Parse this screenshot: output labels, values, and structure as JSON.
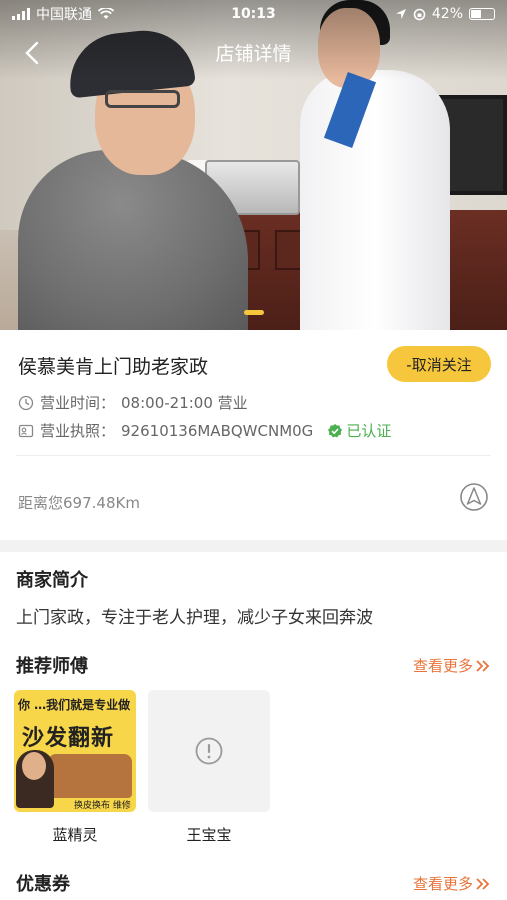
{
  "status_bar": {
    "carrier": "中国联通",
    "time": "10:13",
    "battery": "42%"
  },
  "nav": {
    "title": "店铺详情"
  },
  "store": {
    "name": "侯慕美肯上门助老家政",
    "follow_label": "-取消关注",
    "hours_label": "营业时间：",
    "hours_value": "08:00-21:00 营业",
    "license_label": "营业执照：",
    "license_value": "92610136MABQWCNM0G",
    "verified_label": "已认证",
    "distance": "距离您697.48Km"
  },
  "intro": {
    "title": "商家简介",
    "text": "上门家政，专注于老人护理，减少子女来回奔波"
  },
  "recommend": {
    "title": "推荐师傅",
    "more_label": "查看更多",
    "items": [
      {
        "name": "蓝精灵",
        "thumb_line1": "你 …我们就是专业做",
        "thumb_big": "沙发翻新",
        "thumb_foot": "换皮换布 维修维修"
      },
      {
        "name": "王宝宝"
      }
    ]
  },
  "coupons": {
    "title": "优惠券",
    "more_label": "查看更多"
  },
  "colors": {
    "accent": "#f6c63c",
    "link": "#e8743b",
    "verified": "#4caf50"
  }
}
